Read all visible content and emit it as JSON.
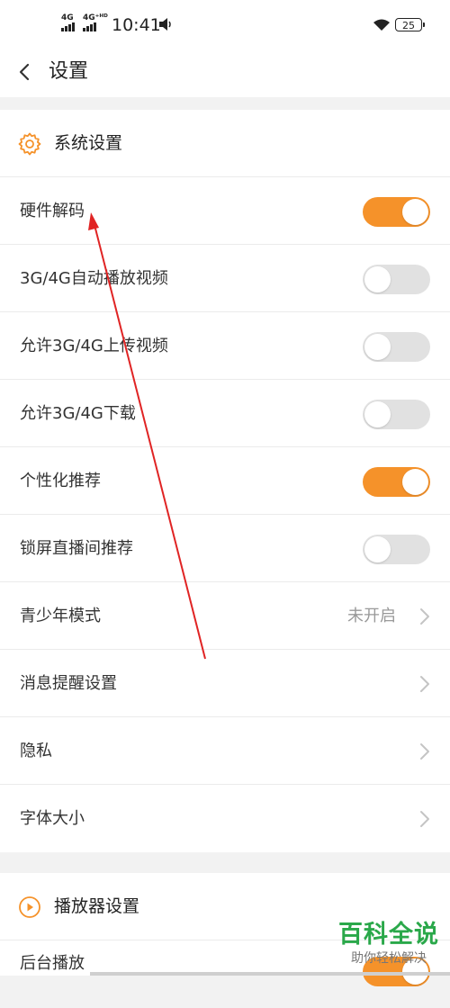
{
  "status_bar": {
    "signal1_label": "4G",
    "signal2_label": "4G⁺ᴴᴰ",
    "time": "10:41",
    "battery": "25"
  },
  "header": {
    "title": "设置"
  },
  "system_section": {
    "title": "系统设置",
    "items": [
      {
        "label": "硬件解码",
        "toggle_on": true
      },
      {
        "label": "3G/4G自动播放视频",
        "toggle_on": false
      },
      {
        "label": "允许3G/4G上传视频",
        "toggle_on": false
      },
      {
        "label": "允许3G/4G下载",
        "toggle_on": false
      },
      {
        "label": "个性化推荐",
        "toggle_on": true
      },
      {
        "label": "锁屏直播间推荐",
        "toggle_on": false
      },
      {
        "label": "青少年模式",
        "value": "未开启"
      },
      {
        "label": "消息提醒设置"
      },
      {
        "label": "隐私"
      },
      {
        "label": "字体大小"
      }
    ]
  },
  "player_section": {
    "title": "播放器设置",
    "items": [
      {
        "label": "后台播放",
        "toggle_on": true
      }
    ]
  },
  "watermark": {
    "title": "百科全说",
    "subtitle": "助你轻松解决"
  },
  "colors": {
    "accent": "#f5922a",
    "toggle_off": "#e1e1e1",
    "watermark": "#2aa84a"
  }
}
